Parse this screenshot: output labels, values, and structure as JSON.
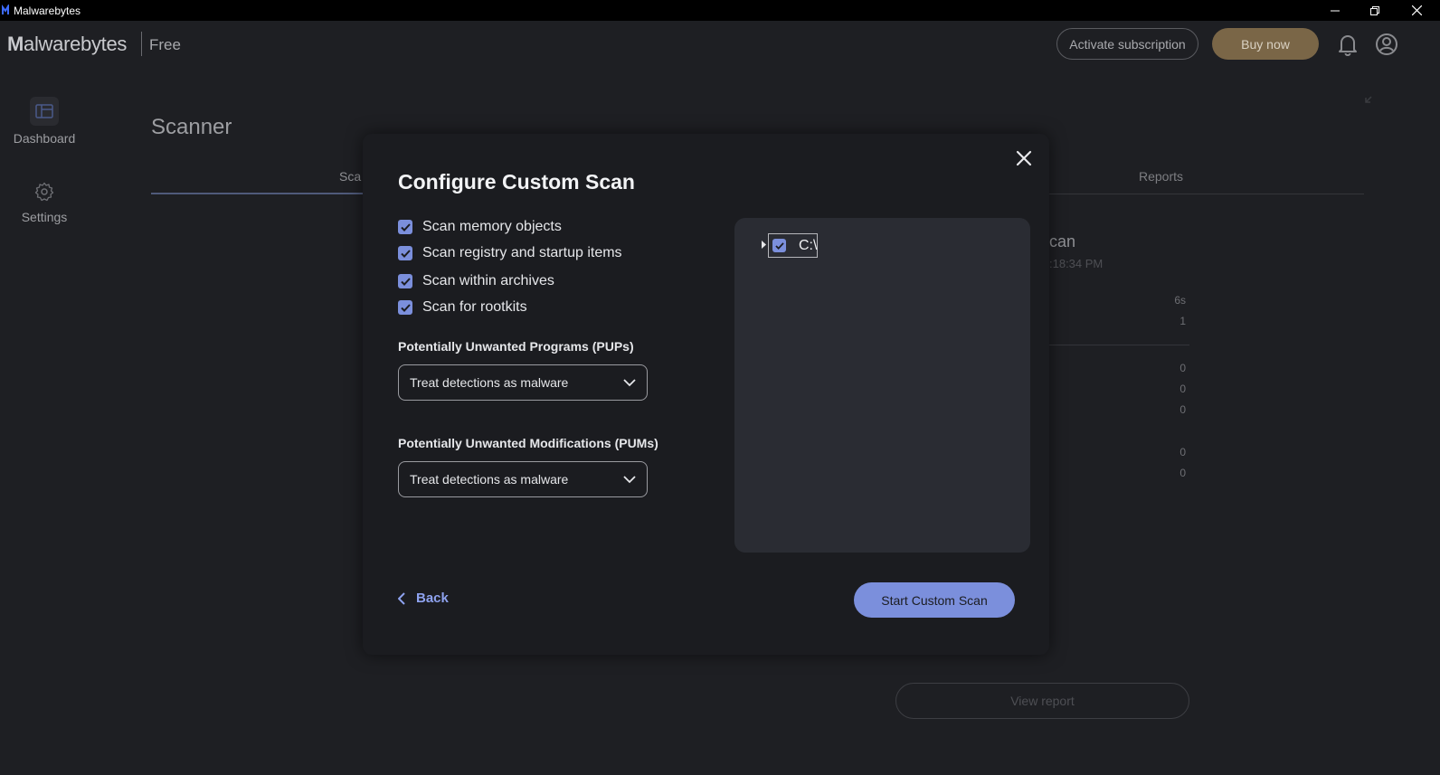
{
  "window": {
    "title": "Malwarebytes"
  },
  "header": {
    "logo_bold": "M",
    "logo_rest": "alwarebytes",
    "edition": "Free",
    "activate_label": "Activate subscription",
    "buy_label": "Buy now"
  },
  "sidebar": {
    "items": [
      {
        "label": "Dashboard",
        "icon": "dashboard-icon"
      },
      {
        "label": "Settings",
        "icon": "gear-icon"
      }
    ]
  },
  "main": {
    "title": "Scanner",
    "tabs": [
      {
        "label": "Scan",
        "visible_text": "Sca"
      },
      {
        "label": "Reports"
      }
    ],
    "background_scan": {
      "title_fragment": "can",
      "time_fragment": ":18:34 PM",
      "values": [
        "6s",
        "1",
        "0",
        "0",
        "0",
        "0",
        "0"
      ],
      "view_report_label": "View report"
    }
  },
  "modal": {
    "title": "Configure Custom Scan",
    "options": [
      {
        "label": "Scan memory objects",
        "checked": true
      },
      {
        "label": "Scan registry and startup items",
        "checked": true
      },
      {
        "label": "Scan within archives",
        "checked": true
      },
      {
        "label": "Scan for rootkits",
        "checked": true
      }
    ],
    "pups": {
      "label": "Potentially Unwanted Programs (PUPs)",
      "selected": "Treat detections as malware"
    },
    "pums": {
      "label": "Potentially Unwanted Modifications (PUMs)",
      "selected": "Treat detections as malware"
    },
    "tree": {
      "root_label": "C:\\",
      "checked": true
    },
    "back_label": "Back",
    "start_label": "Start Custom Scan"
  },
  "colors": {
    "accent": "#7b8fdc",
    "buy_button": "#7a6647",
    "background": "#1e1f23",
    "modal": "#1b1c20",
    "tree_panel": "#2a2c33"
  }
}
